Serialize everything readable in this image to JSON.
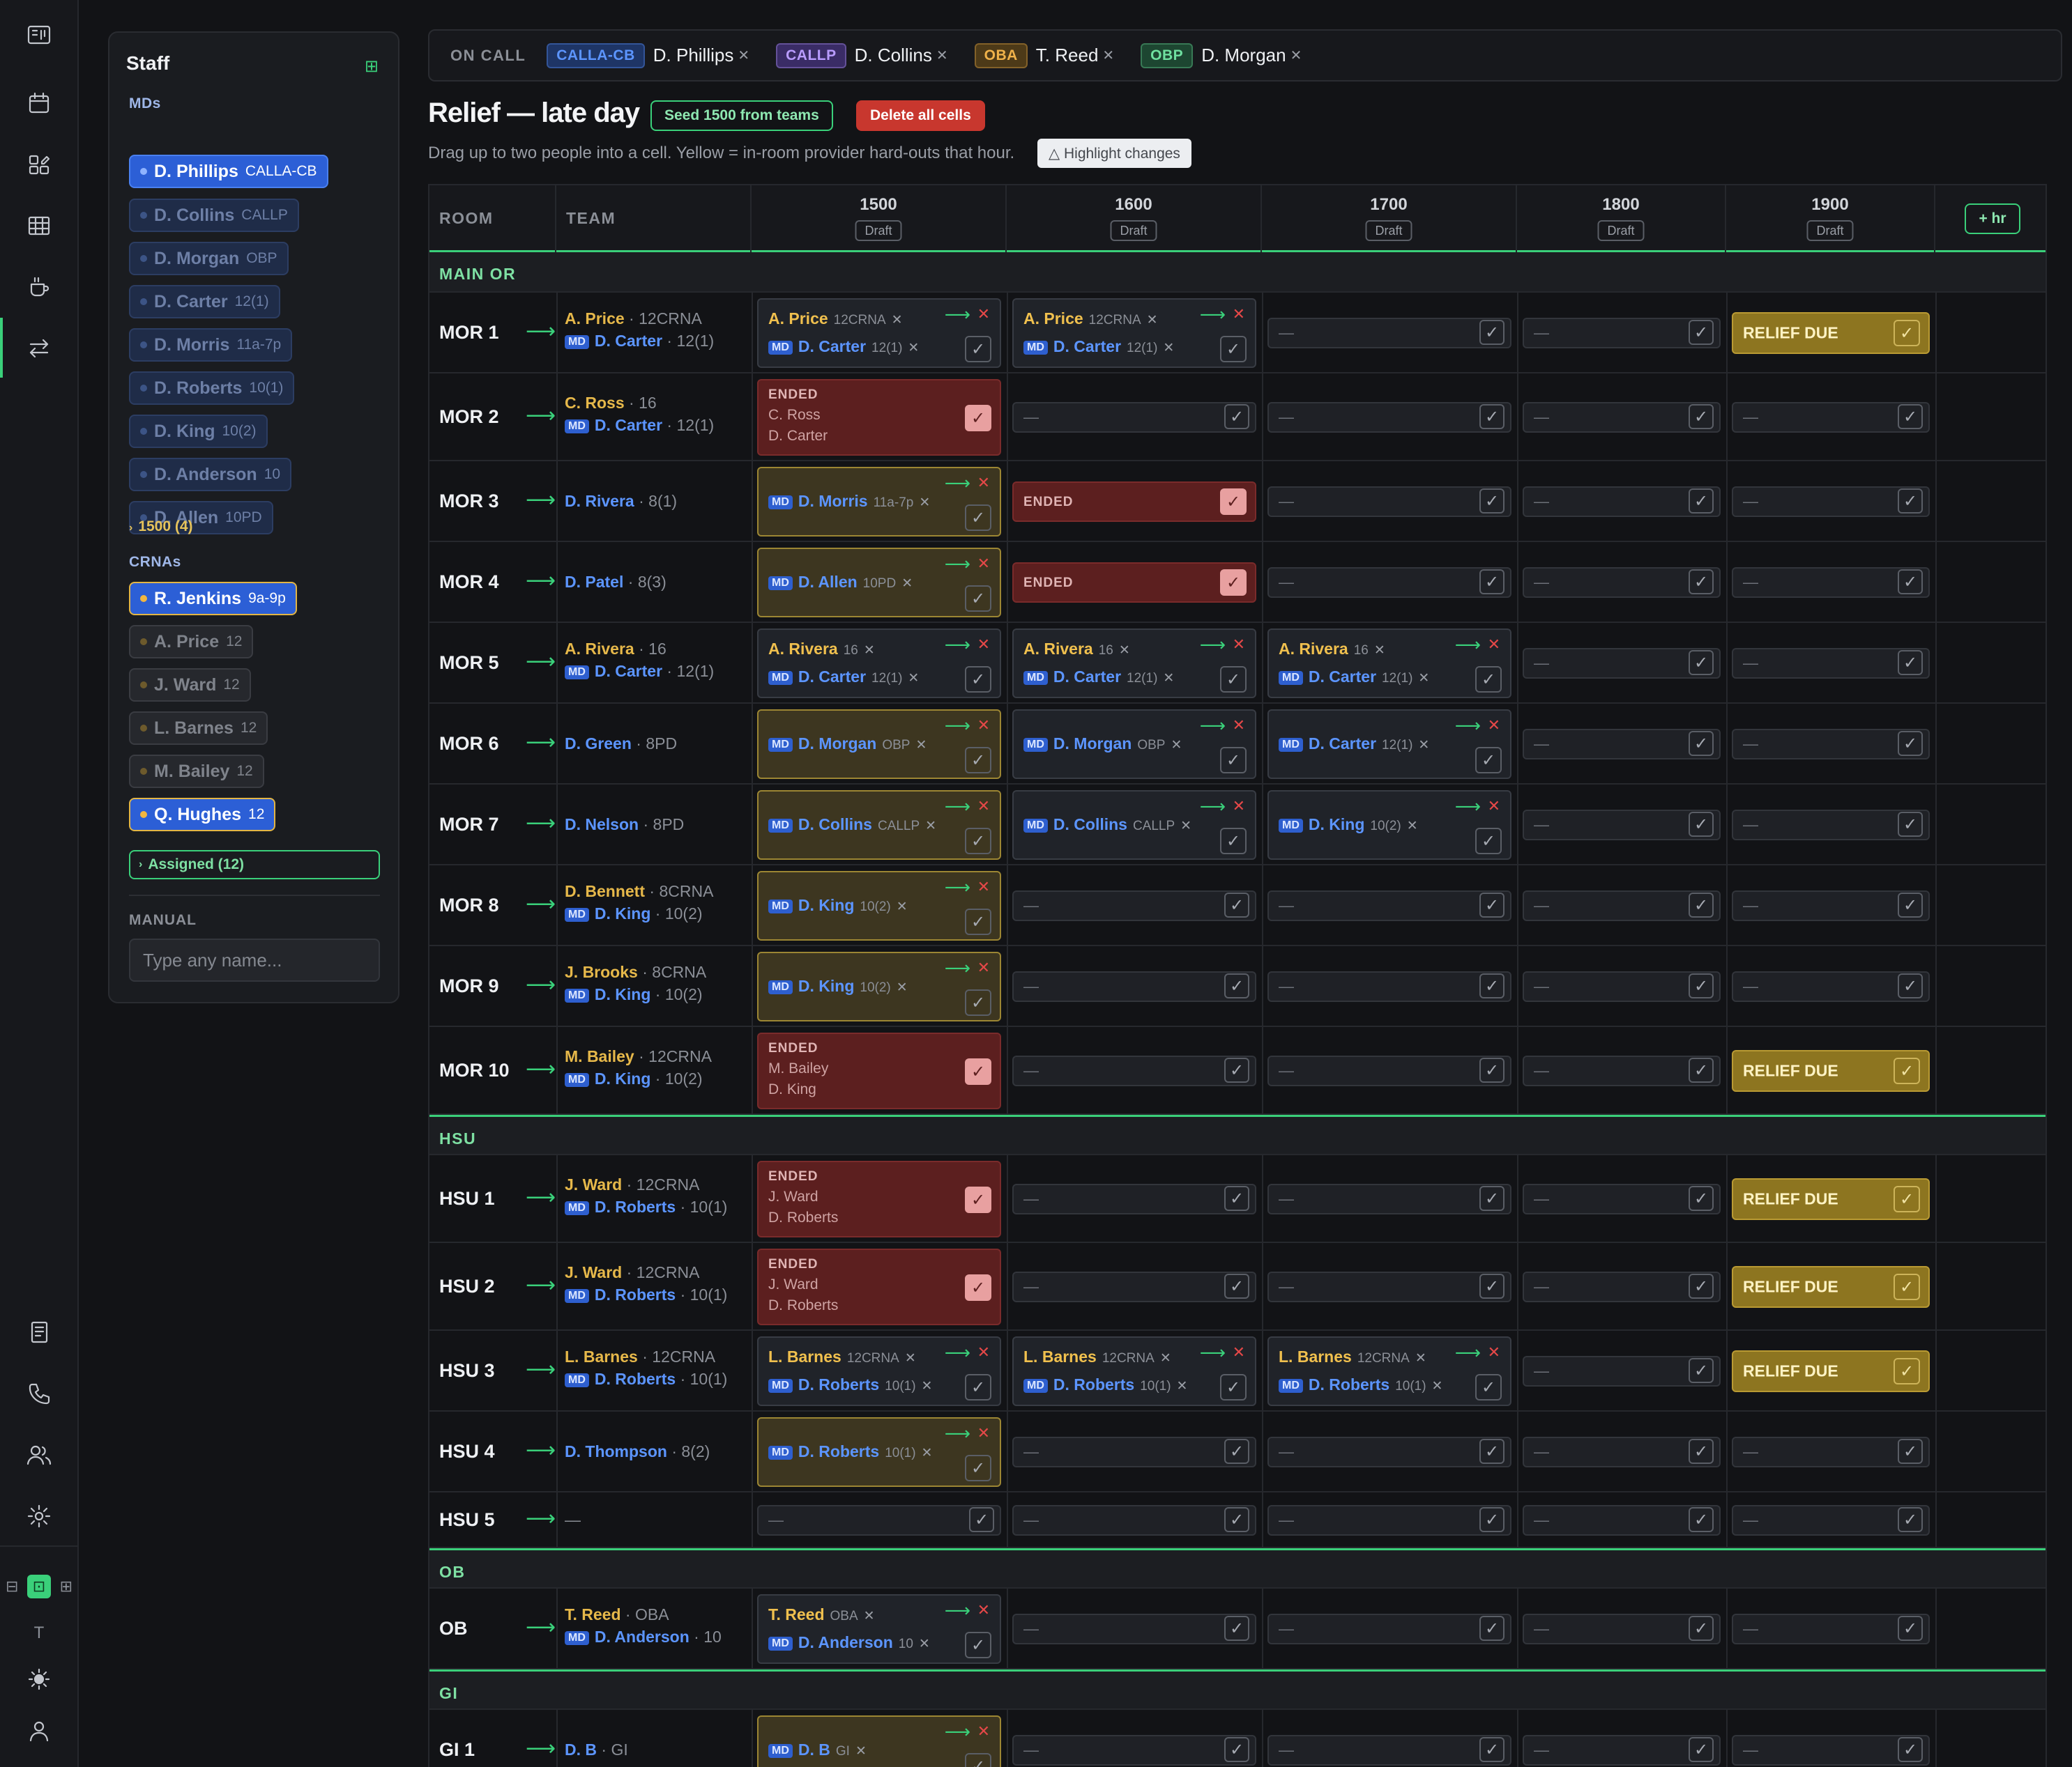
{
  "staff": {
    "title": "Staff",
    "mds_label": "MDs",
    "mds": [
      {
        "name": "D. Phillips",
        "tag": "CALLA-CB",
        "on": true
      },
      {
        "name": "D. Collins",
        "tag": "CALLP",
        "on": false
      },
      {
        "name": "D. Morgan",
        "tag": "OBP",
        "on": false
      },
      {
        "name": "D. Carter",
        "tag": "12(1)",
        "on": false
      },
      {
        "name": "D. Morris",
        "tag": "11a-7p",
        "on": false
      },
      {
        "name": "D. Roberts",
        "tag": "10(1)",
        "on": false
      },
      {
        "name": "D. King",
        "tag": "10(2)",
        "on": false
      },
      {
        "name": "D. Anderson",
        "tag": "10",
        "on": false
      },
      {
        "name": "D. Allen",
        "tag": "10PD",
        "on": false
      }
    ],
    "collapsed_group": "1500 (4)",
    "crnas_label": "CRNAs",
    "crnas": [
      {
        "name": "R. Jenkins",
        "tag": "9a-9p",
        "on": true
      },
      {
        "name": "A. Price",
        "tag": "12",
        "on": false
      },
      {
        "name": "J. Ward",
        "tag": "12",
        "on": false
      },
      {
        "name": "L. Barnes",
        "tag": "12",
        "on": false
      },
      {
        "name": "M. Bailey",
        "tag": "12",
        "on": false
      },
      {
        "name": "Q. Hughes",
        "tag": "12",
        "on": true
      }
    ],
    "assigned": "Assigned (12)",
    "manual_label": "MANUAL",
    "manual_placeholder": "Type any name..."
  },
  "oncall": {
    "label": "ON CALL",
    "items": [
      {
        "tag": "CALLA-CB",
        "name": "D. Phillips",
        "color": "#5c95ff",
        "bg": "#1e3566"
      },
      {
        "tag": "CALLP",
        "name": "D. Collins",
        "color": "#b99cff",
        "bg": "#3a2c66"
      },
      {
        "tag": "OBA",
        "name": "T. Reed",
        "color": "#f0b24a",
        "bg": "#4d3a18"
      },
      {
        "tag": "OBP",
        "name": "D. Morgan",
        "color": "#6fe0a0",
        "bg": "#1d4631"
      }
    ]
  },
  "header": {
    "title": "Relief — late day",
    "seed_button": "Seed 1500 from teams",
    "delete_button": "Delete all cells",
    "hint": "Drag up to two people into a cell. Yellow = in-room provider hard-outs that hour.",
    "highlight_button": "△ Highlight changes"
  },
  "grid": {
    "col_room": "ROOM",
    "col_team": "TEAM",
    "hours": [
      "1500",
      "1600",
      "1700",
      "1800",
      "1900"
    ],
    "draft": "Draft",
    "add_hour": "+ hr",
    "ended_label": "ENDED",
    "due_label": "RELIEF DUE",
    "sections": [
      {
        "name": "MAIN OR",
        "rows": [
          {
            "room": "MOR 1",
            "team": {
              "crna": "A. Price",
              "crna_sub": "12CRNA",
              "md": "D. Carter",
              "md_sub": "12(1)"
            },
            "cells": [
              {
                "k": "a",
                "y": false,
                "crna": "A. Price",
                "crna_sub": "12CRNA",
                "md": "D. Carter",
                "md_sub": "12(1)"
              },
              {
                "k": "a",
                "y": false,
                "crna": "A. Price",
                "crna_sub": "12CRNA",
                "md": "D. Carter",
                "md_sub": "12(1)"
              },
              {
                "k": "e"
              },
              {
                "k": "e"
              },
              {
                "k": "d"
              }
            ]
          },
          {
            "room": "MOR 2",
            "team": {
              "crna": "C. Ross",
              "crna_sub": "16",
              "md": "D. Carter",
              "md_sub": "12(1)"
            },
            "cells": [
              {
                "k": "x",
                "l1": "C. Ross",
                "l2": "D. Carter"
              },
              {
                "k": "e"
              },
              {
                "k": "e"
              },
              {
                "k": "e"
              },
              {
                "k": "e"
              }
            ]
          },
          {
            "room": "MOR 3",
            "team": {
              "md": "D. Rivera",
              "md_sub": "8(1)"
            },
            "cells": [
              {
                "k": "a",
                "y": true,
                "md": "D. Morris",
                "md_sub": "11a-7p"
              },
              {
                "k": "xs"
              },
              {
                "k": "e"
              },
              {
                "k": "e"
              },
              {
                "k": "e"
              }
            ]
          },
          {
            "room": "MOR 4",
            "team": {
              "md": "D. Patel",
              "md_sub": "8(3)"
            },
            "cells": [
              {
                "k": "a",
                "y": true,
                "md": "D. Allen",
                "md_sub": "10PD"
              },
              {
                "k": "xs"
              },
              {
                "k": "e"
              },
              {
                "k": "e"
              },
              {
                "k": "e"
              }
            ]
          },
          {
            "room": "MOR 5",
            "team": {
              "crna": "A. Rivera",
              "crna_sub": "16",
              "md": "D. Carter",
              "md_sub": "12(1)"
            },
            "cells": [
              {
                "k": "a",
                "y": false,
                "crna": "A. Rivera",
                "crna_sub": "16",
                "md": "D. Carter",
                "md_sub": "12(1)"
              },
              {
                "k": "a",
                "y": false,
                "crna": "A. Rivera",
                "crna_sub": "16",
                "md": "D. Carter",
                "md_sub": "12(1)"
              },
              {
                "k": "a",
                "y": false,
                "crna": "A. Rivera",
                "crna_sub": "16",
                "md": "D. Carter",
                "md_sub": "12(1)"
              },
              {
                "k": "e"
              },
              {
                "k": "e"
              }
            ]
          },
          {
            "room": "MOR 6",
            "team": {
              "md": "D. Green",
              "md_sub": "8PD"
            },
            "cells": [
              {
                "k": "a",
                "y": true,
                "md": "D. Morgan",
                "md_sub": "OBP"
              },
              {
                "k": "a",
                "y": false,
                "md": "D. Morgan",
                "md_sub": "OBP"
              },
              {
                "k": "a",
                "y": false,
                "md": "D. Carter",
                "md_sub": "12(1)"
              },
              {
                "k": "e"
              },
              {
                "k": "e"
              }
            ]
          },
          {
            "room": "MOR 7",
            "team": {
              "md": "D. Nelson",
              "md_sub": "8PD"
            },
            "cells": [
              {
                "k": "a",
                "y": true,
                "md": "D. Collins",
                "md_sub": "CALLP"
              },
              {
                "k": "a",
                "y": false,
                "md": "D. Collins",
                "md_sub": "CALLP"
              },
              {
                "k": "a",
                "y": false,
                "md": "D. King",
                "md_sub": "10(2)"
              },
              {
                "k": "e"
              },
              {
                "k": "e"
              }
            ]
          },
          {
            "room": "MOR 8",
            "team": {
              "crna": "D. Bennett",
              "crna_sub": "8CRNA",
              "md": "D. King",
              "md_sub": "10(2)"
            },
            "cells": [
              {
                "k": "a",
                "y": true,
                "md": "D. King",
                "md_sub": "10(2)"
              },
              {
                "k": "e"
              },
              {
                "k": "e"
              },
              {
                "k": "e"
              },
              {
                "k": "e"
              }
            ]
          },
          {
            "room": "MOR 9",
            "team": {
              "crna": "J. Brooks",
              "crna_sub": "8CRNA",
              "md": "D. King",
              "md_sub": "10(2)"
            },
            "cells": [
              {
                "k": "a",
                "y": true,
                "md": "D. King",
                "md_sub": "10(2)"
              },
              {
                "k": "e"
              },
              {
                "k": "e"
              },
              {
                "k": "e"
              },
              {
                "k": "e"
              }
            ]
          },
          {
            "room": "MOR 10",
            "team": {
              "crna": "M. Bailey",
              "crna_sub": "12CRNA",
              "md": "D. King",
              "md_sub": "10(2)"
            },
            "cells": [
              {
                "k": "x",
                "l1": "M. Bailey",
                "l2": "D. King"
              },
              {
                "k": "e"
              },
              {
                "k": "e"
              },
              {
                "k": "e"
              },
              {
                "k": "d"
              }
            ]
          }
        ]
      },
      {
        "name": "HSU",
        "rows": [
          {
            "room": "HSU 1",
            "team": {
              "crna": "J. Ward",
              "crna_sub": "12CRNA",
              "md": "D. Roberts",
              "md_sub": "10(1)"
            },
            "cells": [
              {
                "k": "x",
                "l1": "J. Ward",
                "l2": "D. Roberts"
              },
              {
                "k": "e"
              },
              {
                "k": "e"
              },
              {
                "k": "e"
              },
              {
                "k": "d"
              }
            ]
          },
          {
            "room": "HSU 2",
            "team": {
              "crna": "J. Ward",
              "crna_sub": "12CRNA",
              "md": "D. Roberts",
              "md_sub": "10(1)"
            },
            "cells": [
              {
                "k": "x",
                "l1": "J. Ward",
                "l2": "D. Roberts"
              },
              {
                "k": "e"
              },
              {
                "k": "e"
              },
              {
                "k": "e"
              },
              {
                "k": "d"
              }
            ]
          },
          {
            "room": "HSU 3",
            "team": {
              "crna": "L. Barnes",
              "crna_sub": "12CRNA",
              "md": "D. Roberts",
              "md_sub": "10(1)"
            },
            "cells": [
              {
                "k": "a",
                "y": false,
                "crna": "L. Barnes",
                "crna_sub": "12CRNA",
                "md": "D. Roberts",
                "md_sub": "10(1)"
              },
              {
                "k": "a",
                "y": false,
                "crna": "L. Barnes",
                "crna_sub": "12CRNA",
                "md": "D. Roberts",
                "md_sub": "10(1)"
              },
              {
                "k": "a",
                "y": false,
                "crna": "L. Barnes",
                "crna_sub": "12CRNA",
                "md": "D. Roberts",
                "md_sub": "10(1)"
              },
              {
                "k": "e"
              },
              {
                "k": "d"
              }
            ]
          },
          {
            "room": "HSU 4",
            "team": {
              "md": "D. Thompson",
              "md_sub": "8(2)"
            },
            "cells": [
              {
                "k": "a",
                "y": true,
                "md": "D. Roberts",
                "md_sub": "10(1)"
              },
              {
                "k": "e"
              },
              {
                "k": "e"
              },
              {
                "k": "e"
              },
              {
                "k": "e"
              }
            ]
          },
          {
            "room": "HSU 5",
            "team": {
              "none": "—"
            },
            "cells": [
              {
                "k": "e"
              },
              {
                "k": "e"
              },
              {
                "k": "e"
              },
              {
                "k": "e"
              },
              {
                "k": "e"
              }
            ]
          }
        ]
      },
      {
        "name": "OB",
        "rows": [
          {
            "room": "OB",
            "team": {
              "crna": "T. Reed",
              "crna_sub": "OBA",
              "md": "D. Anderson",
              "md_sub": "10"
            },
            "cells": [
              {
                "k": "a",
                "y": false,
                "crna": "T. Reed",
                "crna_sub": "OBA",
                "md": "D. Anderson",
                "md_sub": "10"
              },
              {
                "k": "e"
              },
              {
                "k": "e"
              },
              {
                "k": "e"
              },
              {
                "k": "e"
              }
            ]
          }
        ]
      },
      {
        "name": "GI",
        "rows": [
          {
            "room": "GI 1",
            "team": {
              "md": "D. B",
              "md_sub": "GI"
            },
            "cells": [
              {
                "k": "a",
                "y": true,
                "md": "D. B",
                "md_sub": "GI"
              },
              {
                "k": "e"
              },
              {
                "k": "e"
              },
              {
                "k": "e"
              },
              {
                "k": "e"
              }
            ]
          }
        ]
      }
    ]
  }
}
